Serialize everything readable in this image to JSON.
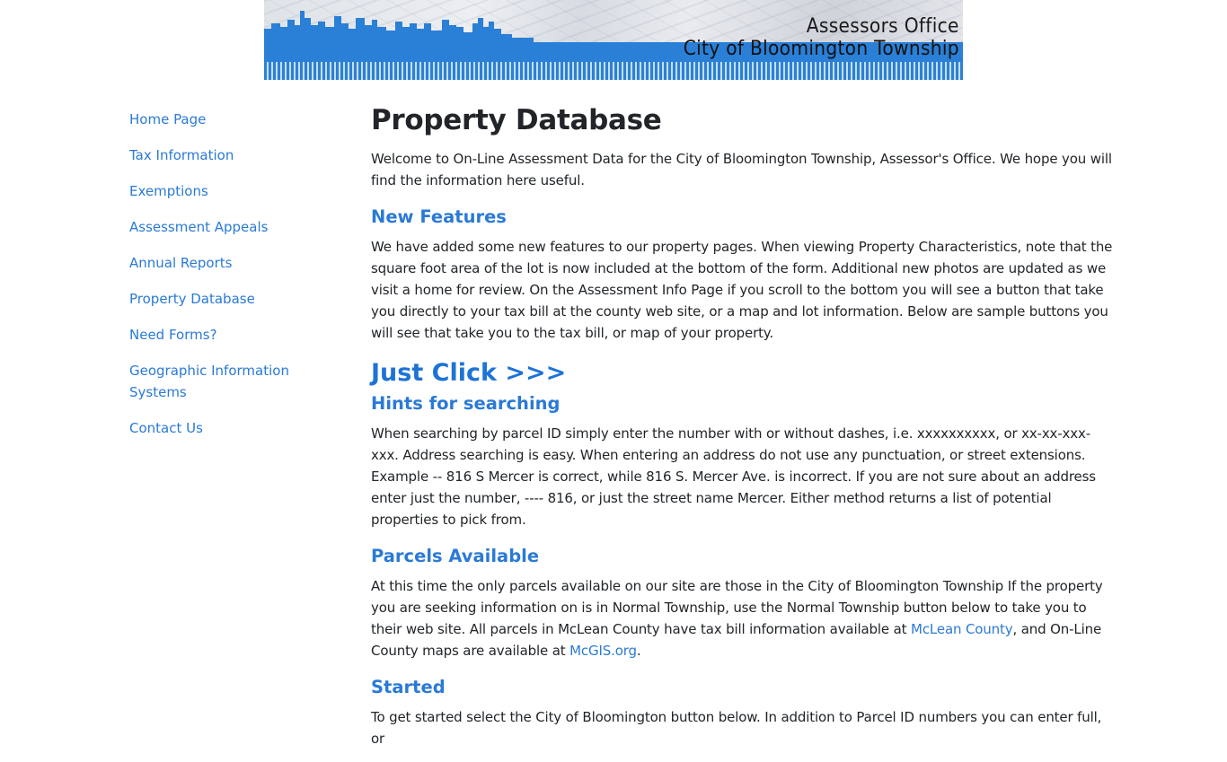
{
  "banner": {
    "title_line1": "Assessors Office",
    "title_line2": "City of Bloomington Township"
  },
  "sidebar": {
    "items": [
      {
        "label": "Home Page"
      },
      {
        "label": "Tax Information"
      },
      {
        "label": "Exemptions"
      },
      {
        "label": "Assessment Appeals"
      },
      {
        "label": "Annual Reports"
      },
      {
        "label": "Property Database"
      },
      {
        "label": "Need Forms?"
      },
      {
        "label": "Geographic Information Systems"
      },
      {
        "label": "Contact Us"
      }
    ]
  },
  "main": {
    "page_title": "Property Database",
    "intro": "Welcome to On-Line Assessment Data for the City of Bloomington Township, Assessor's Office. We hope you will find the information here useful.",
    "new_features": {
      "heading": "New Features",
      "body": "We have added some new features to our property pages. When viewing Property Characteristics, note that the square foot area of the lot is now included at the bottom of the form. Additional new photos are updated as we visit a home for review. On the Assessment Info Page if you scroll to the bottom you will see a button that take you directly to your tax bill at the county web site, or a map and lot information. Below are sample buttons you will see that take you to the tax bill, or map of your property."
    },
    "just_click": "Just Click >>>",
    "hints": {
      "heading": "Hints for searching",
      "body": "When searching by parcel ID simply enter the number with or without dashes, i.e. xxxxxxxxxx, or xx-xx-xxx-xxx. Address searching is easy. When entering an address do not use any punctuation, or street extensions. Example -- 816 S Mercer is correct, while 816 S. Mercer Ave. is incorrect. If you are not sure about an address enter just the number, ---- 816, or just the street name Mercer. Either method returns a list of potential properties to pick from."
    },
    "parcels": {
      "heading": "Parcels Available",
      "body_part1": "At this time the only parcels available on our site are those in the City of Bloomington Township If the property you are seeking information on is in Normal Township, use the Normal Township button below to take you to their web site. All parcels in McLean County have tax bill information available at ",
      "link1": "McLean County",
      "body_part2": ", and On-Line County maps are available at ",
      "link2": "McGIS.org",
      "body_part3": "."
    },
    "started": {
      "heading": "Started",
      "body": "To get started select the City of Bloomington button below. In addition to Parcel ID numbers you can enter full, or"
    }
  },
  "colors": {
    "link": "#2a7ad5",
    "banner_blue": "#2a7fd6",
    "text": "#212529"
  }
}
